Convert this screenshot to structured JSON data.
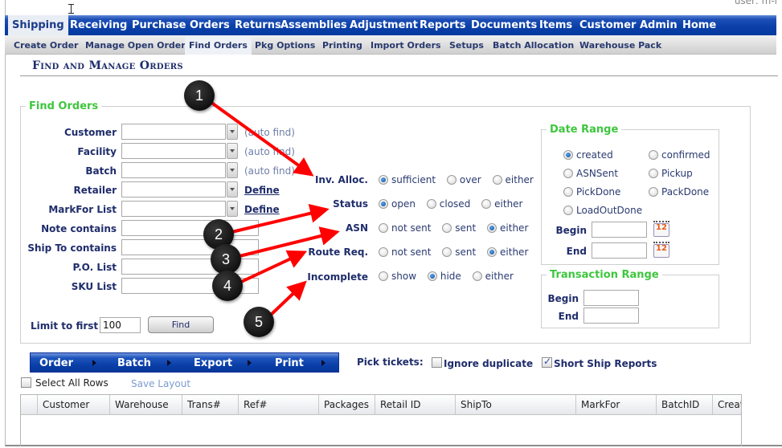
{
  "header": {
    "user_label": "user: m-l"
  },
  "main_nav": [
    {
      "label": "Shipping",
      "active": true
    },
    {
      "label": "Receiving"
    },
    {
      "label": "Purchase Orders"
    },
    {
      "label": "Returns"
    },
    {
      "label": "Assemblies"
    },
    {
      "label": "Adjustment"
    },
    {
      "label": "Reports"
    },
    {
      "label": "Documents"
    },
    {
      "label": "Items"
    },
    {
      "label": "Customer"
    },
    {
      "label": "Admin"
    },
    {
      "label": "Home"
    }
  ],
  "sub_nav": [
    {
      "label": "Create Order"
    },
    {
      "label": "Manage Open Order"
    },
    {
      "label": "Find Orders",
      "active": true
    },
    {
      "label": "Pkg Options"
    },
    {
      "label": "Printing"
    },
    {
      "label": "Import Orders"
    },
    {
      "label": "Setups"
    },
    {
      "label": "Batch Allocation"
    },
    {
      "label": "Warehouse Pack"
    }
  ],
  "page_title": "Find and Manage Orders",
  "find_orders": {
    "legend": "Find Orders",
    "fields": {
      "customer": {
        "label": "Customer",
        "value": "",
        "hint": "(auto find)"
      },
      "facility": {
        "label": "Facility",
        "value": "",
        "hint": "(auto find)"
      },
      "batch": {
        "label": "Batch",
        "value": "",
        "hint": "(auto find)"
      },
      "retailer": {
        "label": "Retailer",
        "value": "",
        "link": "Define"
      },
      "markfor": {
        "label": "MarkFor List",
        "value": "",
        "link": "Define"
      },
      "note": {
        "label": "Note contains",
        "value": ""
      },
      "shipto": {
        "label": "Ship To contains",
        "value": ""
      },
      "po": {
        "label": "P.O. List",
        "value": ""
      },
      "sku": {
        "label": "SKU List",
        "value": ""
      }
    },
    "limit_label": "Limit to first",
    "limit_value": "100",
    "find_button": "Find",
    "radio_groups": {
      "inv_alloc": {
        "label": "Inv. Alloc.",
        "options": [
          "sufficient",
          "over",
          "either"
        ],
        "selected": "sufficient"
      },
      "status": {
        "label": "Status",
        "options": [
          "open",
          "closed",
          "either"
        ],
        "selected": "open"
      },
      "asn": {
        "label": "ASN",
        "options": [
          "not sent",
          "sent",
          "either"
        ],
        "selected": "either"
      },
      "route_req": {
        "label": "Route Req.",
        "options": [
          "not sent",
          "sent",
          "either"
        ],
        "selected": "either"
      },
      "incomplete": {
        "label": "Incomplete",
        "options": [
          "show",
          "hide",
          "either"
        ],
        "selected": "hide"
      }
    }
  },
  "date_range": {
    "legend": "Date Range",
    "options": [
      "created",
      "confirmed",
      "ASNSent",
      "Pickup",
      "PickDone",
      "PackDone",
      "LoadOutDone"
    ],
    "selected": "created",
    "begin_label": "Begin",
    "end_label": "End",
    "begin_value": "",
    "end_value": "",
    "calendar_icon_text": "12"
  },
  "transaction_range": {
    "legend": "Transaction Range",
    "begin_label": "Begin",
    "end_label": "End",
    "begin_value": "",
    "end_value": ""
  },
  "action_bar": [
    "Order",
    "Batch",
    "Export",
    "Print"
  ],
  "pick_tickets": {
    "label": "Pick tickets:",
    "ignore_duplicate": {
      "label": "Ignore duplicate",
      "checked": false
    },
    "short_ship_reports": {
      "label": "Short Ship Reports",
      "checked": true
    }
  },
  "grid": {
    "select_all_label": "Select All Rows",
    "save_layout_label": "Save Layout",
    "columns": [
      "Customer",
      "Warehouse",
      "Trans#",
      "Ref#",
      "Packages",
      "Retail ID",
      "ShipTo",
      "MarkFor",
      "BatchID",
      "Created"
    ],
    "rows": []
  },
  "annotations": [
    "1",
    "2",
    "3",
    "4",
    "5"
  ],
  "colors": {
    "nav_blue": "#0a3fa8",
    "legend_green": "#3ec63e",
    "label_navy": "#1f2d6b",
    "annotation_arrow": "#ff0000"
  }
}
